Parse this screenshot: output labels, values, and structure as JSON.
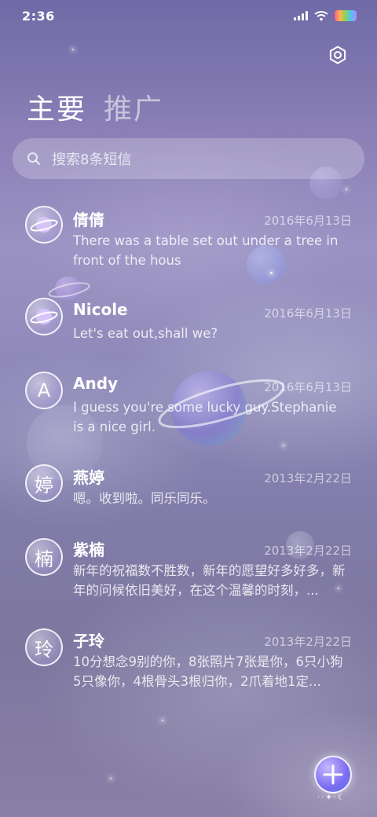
{
  "status_bar": {
    "time": "2:36",
    "icons": [
      "signal-icon",
      "wifi-icon",
      "battery-icon"
    ]
  },
  "header": {
    "settings_icon": "gear-icon",
    "tabs": [
      {
        "label": "主要",
        "active": true
      },
      {
        "label": "推广",
        "active": false
      }
    ]
  },
  "search": {
    "icon": "search-icon",
    "placeholder": "搜索8条短信"
  },
  "messages": [
    {
      "name": "倩倩",
      "avatar_type": "planet",
      "avatar_text": "",
      "date": "2016年6月13日",
      "preview": "There was a table set out under a tree in front of the hous"
    },
    {
      "name": "Nicole",
      "avatar_type": "planet",
      "avatar_text": "",
      "date": "2016年6月13日",
      "preview": "Let's eat out,shall we?"
    },
    {
      "name": "Andy",
      "avatar_type": "letter",
      "avatar_text": "A",
      "date": "2016年6月13日",
      "preview": "I guess you're some lucky guy.Stephanie is a nice girl."
    },
    {
      "name": "燕婷",
      "avatar_type": "letter",
      "avatar_text": "婷",
      "date": "2013年2月22日",
      "preview": "嗯。收到啦。同乐同乐。"
    },
    {
      "name": "紫楠",
      "avatar_type": "letter",
      "avatar_text": "楠",
      "date": "2013年2月22日",
      "preview": "新年的祝福数不胜数，新年的愿望好多好多，新年的问候依旧美好，在这个温馨的时刻，..."
    },
    {
      "name": "子玲",
      "avatar_type": "letter",
      "avatar_text": "玲",
      "date": "2013年2月22日",
      "preview": "10分想念9别的你，8张照片7张是你，6只小狗5只像你，4根骨头3根归你，2爪着地1定..."
    }
  ],
  "fab": {
    "icon": "plus-icon",
    "deco": "··✶·☾"
  },
  "colors": {
    "bg_top": "#6f6aa6",
    "bg_mid": "#9a92c2",
    "bg_bottom": "#7d779f",
    "fab": "#7a6bf0"
  }
}
